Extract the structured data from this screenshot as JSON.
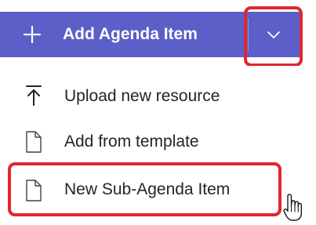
{
  "toolbar": {
    "add_button_label": "Add Agenda Item",
    "add_icon": "plus-icon",
    "dropdown_icon": "chevron-down-icon",
    "accent_color": "#5b5fc7",
    "highlight_color": "#e2262d"
  },
  "menu": {
    "items": [
      {
        "label": "Upload new resource",
        "icon": "upload-icon"
      },
      {
        "label": "Add from template",
        "icon": "document-icon"
      },
      {
        "label": "New Sub-Agenda Item",
        "icon": "document-icon"
      }
    ]
  }
}
